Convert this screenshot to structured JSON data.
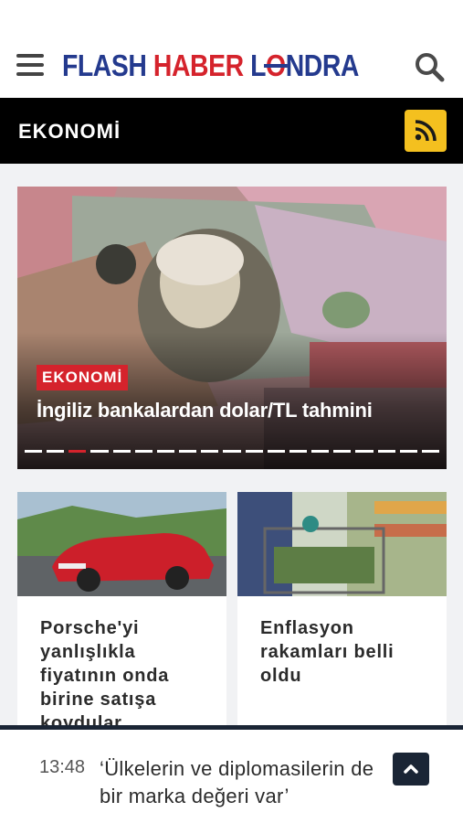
{
  "header": {
    "logo": {
      "part1": "FLASH",
      "part2": "HABER",
      "part3a": "L",
      "part3o": "O",
      "part3b": "NDRA"
    },
    "menu_icon": "hamburger-menu-icon",
    "search_icon": "search-icon"
  },
  "category": {
    "title": "EKONOMİ",
    "rss_icon": "rss-icon"
  },
  "hero": {
    "badge": "EKONOMİ",
    "title": "İngiliz bankalardan dolar/TL tahmini",
    "slides_total": 19,
    "active_slide": 3
  },
  "cards": [
    {
      "title": "Porsche'yi yanlışlıkla fiyatının onda birine satışa koydular"
    },
    {
      "title": "Enflasyon rakamları belli oldu"
    }
  ],
  "ticker": {
    "time": "13:48",
    "text": "‘Ülkelerin ve diplomasilerin de bir marka değeri var’",
    "up_icon": "chevron-up-icon"
  },
  "colors": {
    "brand_blue": "#243a8e",
    "brand_red": "#d5232c",
    "rss_yellow": "#f4c01f",
    "dark": "#1a2535"
  }
}
